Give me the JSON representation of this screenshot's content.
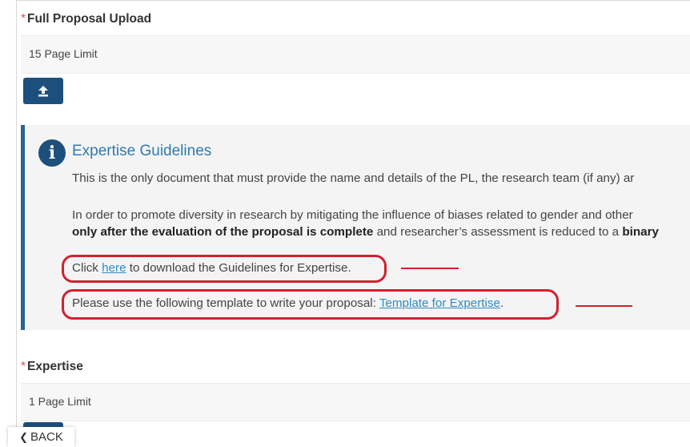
{
  "full_proposal": {
    "required_mark": "*",
    "title": "Full Proposal Upload",
    "limit": "15 Page Limit",
    "upload_icon": "upload-icon"
  },
  "guidelines": {
    "icon": "info-icon",
    "title": "Expertise Guidelines",
    "line1": "This is the only document that must provide the name and details of the PL, the research team (if any) ar",
    "line2": "In order to promote diversity in research by mitigating the influence of biases related to gender and other",
    "line3_bold": "only after the evaluation of the proposal is complete",
    "line3_rest": " and researcher’s assessment is reduced to a ",
    "line3_bold2": "binary",
    "download_prefix": "Click ",
    "download_link": "here",
    "download_suffix": " to download the Guidelines for Expertise.",
    "template_prefix": "Please use the following template to write your proposal: ",
    "template_link": "Template for Expertise",
    "template_suffix": ".",
    "accent_color": "#2a6496",
    "highlight_color": "#d0222e"
  },
  "expertise": {
    "required_mark": "*",
    "title": "Expertise",
    "limit": "1 Page Limit"
  },
  "back_button": {
    "icon": "chevron-left-icon",
    "label": "BACK"
  }
}
